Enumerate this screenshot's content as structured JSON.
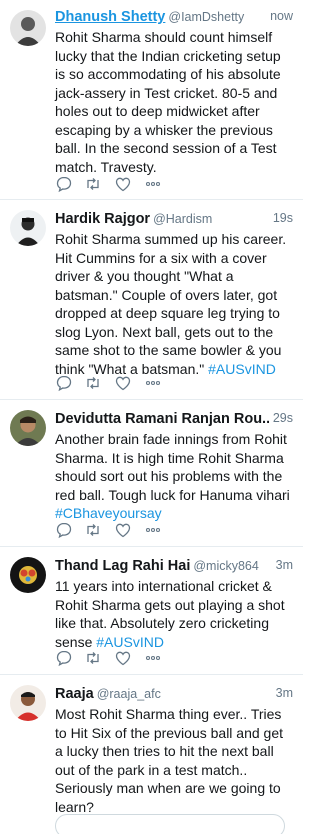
{
  "tweets": [
    {
      "name": "Dhanush Shetty",
      "handle": "@IamDshetty",
      "time": "now",
      "text": "Rohit Sharma should count himself lucky that the Indian cricketing setup is so accommodating of his absolute jack-assery in Test cricket. 80-5 and holes out to deep midwicket after escaping by a whisker the previous ball. In the second session of a Test match. Travesty.",
      "hashtag": ""
    },
    {
      "name": "Hardik Rajgor",
      "handle": "@Hardism",
      "time": "19s",
      "text": "Rohit Sharma summed up his career. Hit Cummins for a six with a cover driver & you thought \"What a batsman.\" Couple of overs later, got dropped at deep square leg trying to slog Lyon. Next ball, gets out to the same shot to the same bowler & you think \"What a batsman.\"",
      "hashtag": "#AUSvIND"
    },
    {
      "name": "Devidutta Ramani Ranjan Rou...",
      "handle": "",
      "time": "29s",
      "text": "Another brain fade innings from Rohit Sharma. It is high time  Rohit Sharma should sort out his problems with the red ball. Tough luck for Hanuma vihari",
      "hashtag": "#CBhaveyoursay"
    },
    {
      "name": "Thand Lag Rahi Hai",
      "handle": "@micky864",
      "time": "3m",
      "text": "11 years into international cricket & Rohit Sharma gets out playing a shot like that. Absolutely zero cricketing sense",
      "hashtag": "#AUSvIND"
    },
    {
      "name": "Raaja",
      "handle": "@raaja_afc",
      "time": "3m",
      "text": "Most Rohit Sharma thing ever.. Tries to Hit Six of the previous ball and get a  lucky then tries to hit the next ball out of the park in a test match.. Seriously man when are we going to learn?",
      "hashtag": ""
    }
  ],
  "colors": {
    "link": "#1b95e0",
    "muted": "#657786",
    "icon": "#657786",
    "divider": "#e6ecf0"
  },
  "icons": [
    "reply-icon",
    "retweet-icon",
    "like-icon",
    "more-icon"
  ]
}
